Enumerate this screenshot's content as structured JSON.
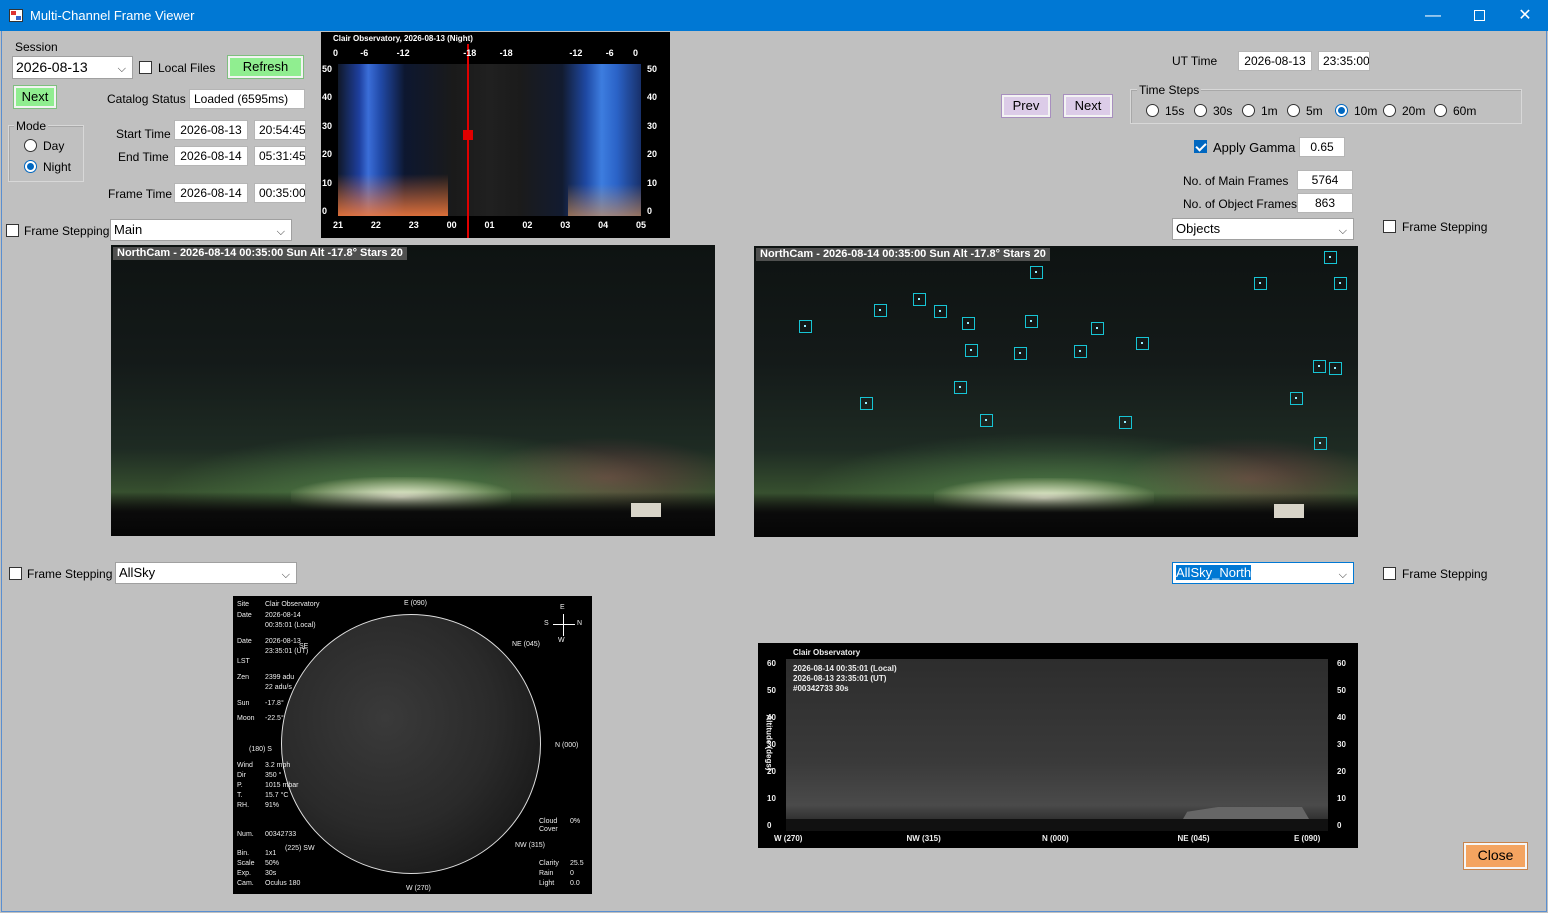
{
  "window": {
    "title": "Multi-Channel Frame Viewer",
    "controls": {
      "minimize": "—",
      "maximize": "",
      "close": "✕"
    }
  },
  "session": {
    "label": "Session",
    "value": "2026-08-13",
    "local_files_label": "Local Files",
    "local_files_checked": false,
    "refresh_label": "Refresh",
    "next_label": "Next",
    "catalog_status_label": "Catalog Status",
    "catalog_status_value": "Loaded (6595ms)"
  },
  "mode": {
    "label": "Mode",
    "options": [
      "Day",
      "Night"
    ],
    "selected": "Night"
  },
  "times": {
    "start_label": "Start Time",
    "start_date": "2026-08-13",
    "start_time": "20:54:45",
    "end_label": "End Time",
    "end_date": "2026-08-14",
    "end_time": "05:31:45",
    "frame_label": "Frame Time",
    "frame_date": "2026-08-14",
    "frame_time": "00:35:00"
  },
  "keogram": {
    "title": "Clair Observatory, 2026-08-13 (Night)",
    "top_ticks": [
      "0",
      "-6",
      "-12",
      "-18",
      "-18",
      "-12",
      "-6",
      "0"
    ],
    "bottom_ticks": [
      "21",
      "22",
      "23",
      "00",
      "01",
      "02",
      "03",
      "04",
      "05"
    ],
    "left_ticks": [
      "50",
      "40",
      "30",
      "20",
      "10",
      "0"
    ],
    "right_ticks": [
      "50",
      "40",
      "30",
      "20",
      "10",
      "0"
    ],
    "cursor_fraction": 0.42,
    "cursor_marker_alt": 28
  },
  "ut": {
    "label": "UT Time",
    "date": "2026-08-13",
    "time": "23:35:00"
  },
  "nav": {
    "prev_label": "Prev",
    "next_label": "Next"
  },
  "time_steps": {
    "label": "Time Steps",
    "options": [
      "15s",
      "30s",
      "1m",
      "5m",
      "10m",
      "20m",
      "60m"
    ],
    "selected": "10m"
  },
  "gamma": {
    "label": "Apply Gamma",
    "checked": true,
    "value": "0.65"
  },
  "counts": {
    "main_label": "No. of Main Frames",
    "main_value": "5764",
    "object_label": "No. of Object Frames",
    "object_value": "863"
  },
  "channels": {
    "frame_stepping_label": "Frame Stepping",
    "top_left": "Main",
    "top_right": "Objects",
    "bottom_left": "AllSky",
    "bottom_right": "AllSky_North"
  },
  "main_pane": {
    "caption": "NorthCam - 2026-08-14 00:35:00  Sun Alt -17.8° Stars 20"
  },
  "objects_pane": {
    "caption": "NorthCam - 2026-08-14 00:35:00  Sun Alt -17.8° Stars 20"
  },
  "allsky": {
    "labels": {
      "site_k": "Site",
      "site_v": "Clair Observatory",
      "date_k": "Date",
      "date_v1": "2026-08-14",
      "date_v2": "00:35:01  (Local)",
      "date2_k": "Date",
      "date2_v1": "2026-08-13",
      "date2_v2": "23:35:01  (UT)",
      "lst_k": "LST",
      "zen_k": "Zen",
      "zen_v1": "2399 adu",
      "zen_v2": "22 adu/s",
      "sun_k": "Sun",
      "sun_v": "-17.8°",
      "moon_k": "Moon",
      "moon_v": "-22.5°",
      "wind_k": "Wind",
      "wind_v": "3.2 mph",
      "dir_k": "Dir",
      "dir_v": "350 °",
      "p_k": "P.",
      "p_v": "1015 mbar",
      "t_k": "T.",
      "t_v": "15.7 °C",
      "rh_k": "RH.",
      "rh_v": "91%",
      "num_k": "Num.",
      "num_v": "00342733",
      "bin_k": "Bin.",
      "bin_v": "1x1",
      "scale_k": "Scale",
      "scale_v": "50%",
      "exp_k": "Exp.",
      "exp_v": "30s",
      "cam_k": "Cam.",
      "cam_v": "Oculus 180",
      "cloud_k": "Cloud Cover",
      "cloud_v": "0%",
      "clarity_k": "Clarity",
      "clarity_v": "25.5",
      "rain_k": "Rain",
      "rain_v": "0",
      "light_k": "Light",
      "light_v": "0.0",
      "dir_e": "E (090)",
      "dir_ne": "NE (045)",
      "dir_n": "N (000)",
      "dir_nw": "NW (315)",
      "dir_w": "W (270)",
      "dir_sw": "(225) SW",
      "dir_s": "(180) S",
      "dir_se": "SE",
      "compass_e": "E",
      "compass_s": "S",
      "compass_n": "N",
      "compass_w": "W"
    }
  },
  "pano": {
    "title": "Clair Observatory",
    "line1": "2026-08-14  00:35:01  (Local)",
    "line2": "2026-08-13  23:35:01  (UT)",
    "line3": "#00342733  30s",
    "ylabel": "Altitude (degs)",
    "y_ticks": [
      "60",
      "50",
      "40",
      "30",
      "20",
      "10",
      "0"
    ],
    "x_ticks": [
      "W (270)",
      "NW (315)",
      "N (000)",
      "NE (045)",
      "E (090)"
    ]
  },
  "close_label": "Close"
}
